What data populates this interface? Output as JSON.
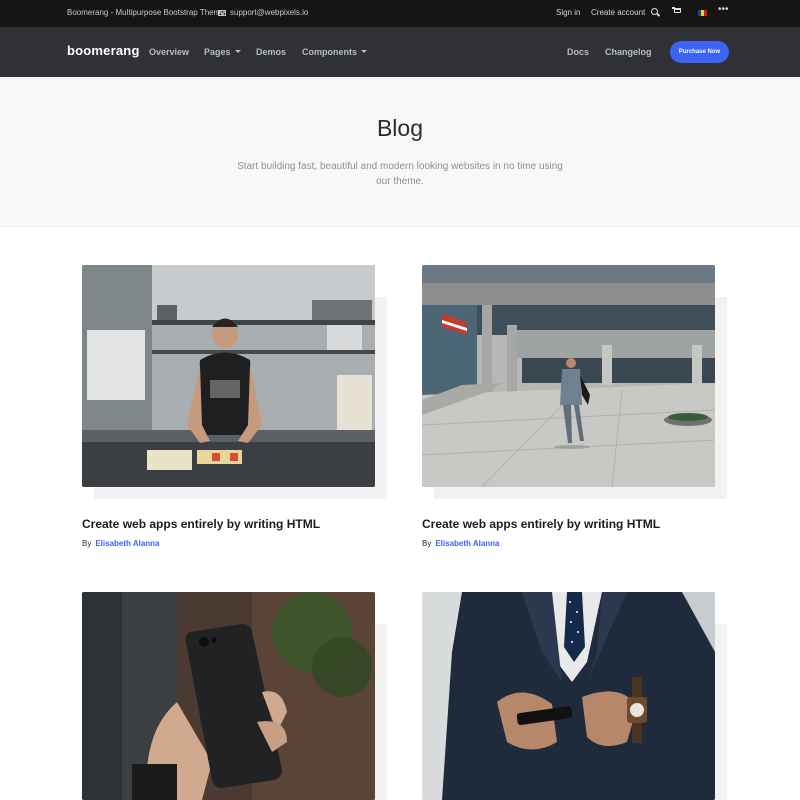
{
  "topbar": {
    "brand_text": "Boomerang - Multipurpose Bootstrap Theme",
    "email": "support@webpixels.io",
    "signin": "Sign in",
    "create_account": "Create account",
    "more": "•••"
  },
  "navbar": {
    "logo": "boomerang",
    "links": {
      "overview": "Overview",
      "pages": "Pages",
      "demos": "Demos",
      "components": "Components",
      "docs": "Docs",
      "changelog": "Changelog"
    },
    "purchase": "Purchase Now",
    "accent_color": "#3d63f2"
  },
  "hero": {
    "title": "Blog",
    "subtitle": "Start building fast, beautiful and modern looking websites in no time using our theme."
  },
  "posts": [
    {
      "title": "Create web apps entirely by writing HTML",
      "by": "By",
      "author": "Elisabeth Alanna",
      "image": "chef-kitchen-photo"
    },
    {
      "title": "Create web apps entirely by writing HTML",
      "by": "By",
      "author": "Elisabeth Alanna",
      "image": "businessman-walking-photo"
    },
    {
      "image": "phone-in-hand-photo"
    },
    {
      "image": "suit-man-phone-photo"
    }
  ]
}
